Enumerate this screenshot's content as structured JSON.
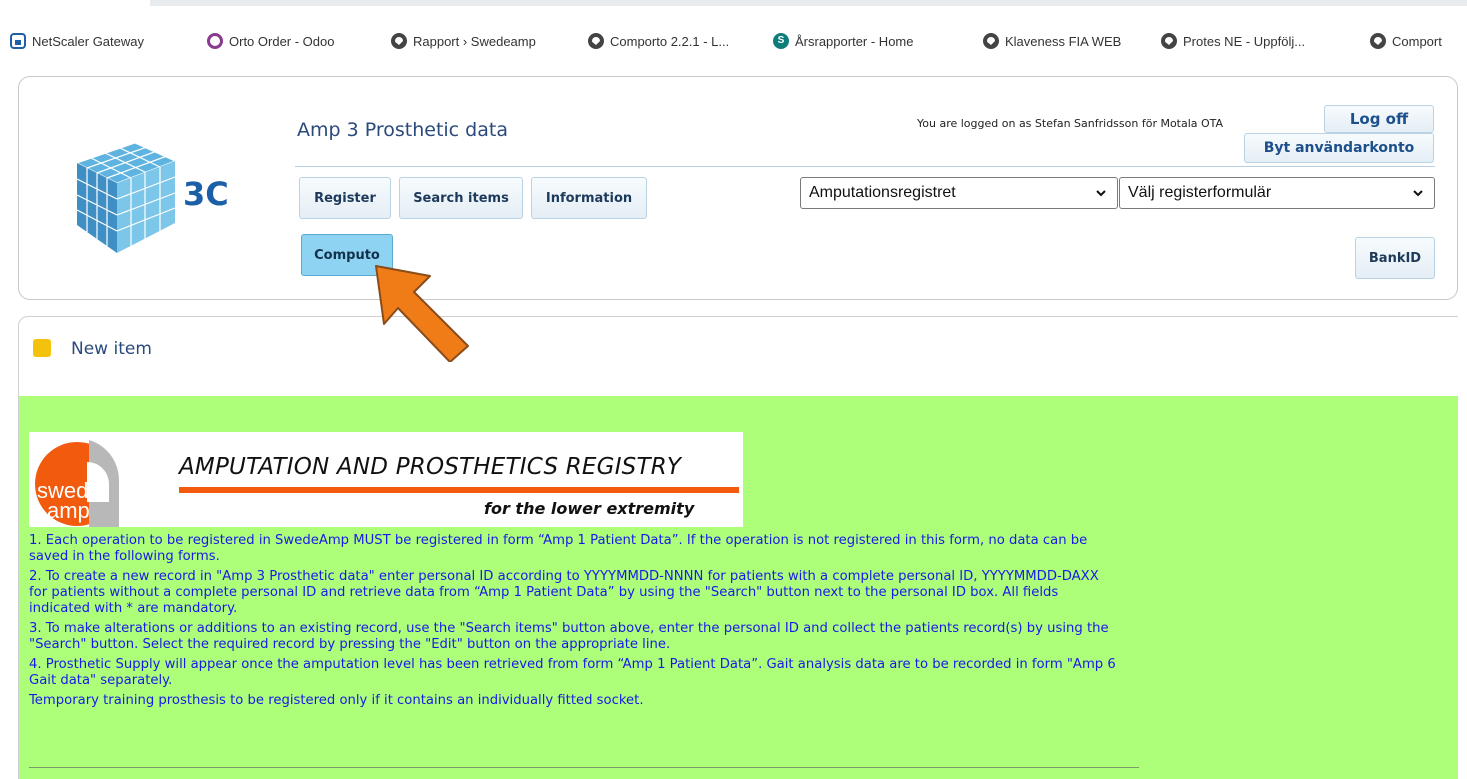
{
  "bookmarks": [
    {
      "label": "NetScaler Gateway",
      "icon": "lock-icon"
    },
    {
      "label": "Orto Order - Odoo",
      "icon": "ring-icon"
    },
    {
      "label": "Rapport › Swedeamp",
      "icon": "globe-icon"
    },
    {
      "label": "Comporto 2.2.1 - L...",
      "icon": "globe-icon"
    },
    {
      "label": "Årsrapporter - Home",
      "icon": "sharepoint-icon"
    },
    {
      "label": "Klaveness FIA WEB",
      "icon": "globe-icon"
    },
    {
      "label": "Protes NE - Uppfölj...",
      "icon": "globe-icon"
    },
    {
      "label": "Comport",
      "icon": "globe-icon"
    }
  ],
  "header": {
    "logo_text": "3C",
    "title": "Amp 3 Prosthetic data",
    "logged_on": "You are logged on as Stefan Sanfridsson för Motala OTA",
    "logoff_label": "Log off",
    "switch_account_label": "Byt användarkonto",
    "nav": {
      "register": "Register",
      "search_items": "Search items",
      "information": "Information",
      "computo": "Computo",
      "bankid": "BankID"
    },
    "registry_select": "Amputationsregistret",
    "form_select": "Välj registerformulär"
  },
  "new_item_label": "New item",
  "banner": {
    "logo_top": "swede",
    "logo_bottom": "amp",
    "title": "AMPUTATION AND PROSTHETICS REGISTRY",
    "subtitle": "for the lower extremity"
  },
  "instructions": [
    "1. Each operation to be registered in SwedeAmp MUST be registered in form “Amp 1 Patient Data”. If the operation is not registered in this form, no data can be saved in the following forms.",
    "2. To create a new record in \"Amp 3 Prosthetic data\" enter personal ID according to YYYYMMDD-NNNN for patients with a complete personal ID, YYYYMMDD-DAXX for patients without a complete personal ID and retrieve data from “Amp 1 Patient Data” by using the \"Search\" button next to the personal ID box. All fields indicated with * are mandatory.",
    "3. To make alterations or additions to an existing record, use the \"Search items\" button above, enter the personal ID and collect the patients record(s) by using the \"Search\" button. Select the required record by pressing the \"Edit\" button on the appropriate line.",
    "4. Prosthetic Supply will appear once the amputation level has been retrieved from form “Amp 1 Patient Data”. Gait analysis data are to be recorded in form \"Amp 6 Gait data\" separately.",
    "Temporary training prosthesis to be registered only if it contains an individually fitted socket."
  ],
  "colors": {
    "content_bg": "#adff7a",
    "active_button": "#8fd3f2",
    "arrow": "#f07c18",
    "instruction_text": "#1a1ae8"
  }
}
